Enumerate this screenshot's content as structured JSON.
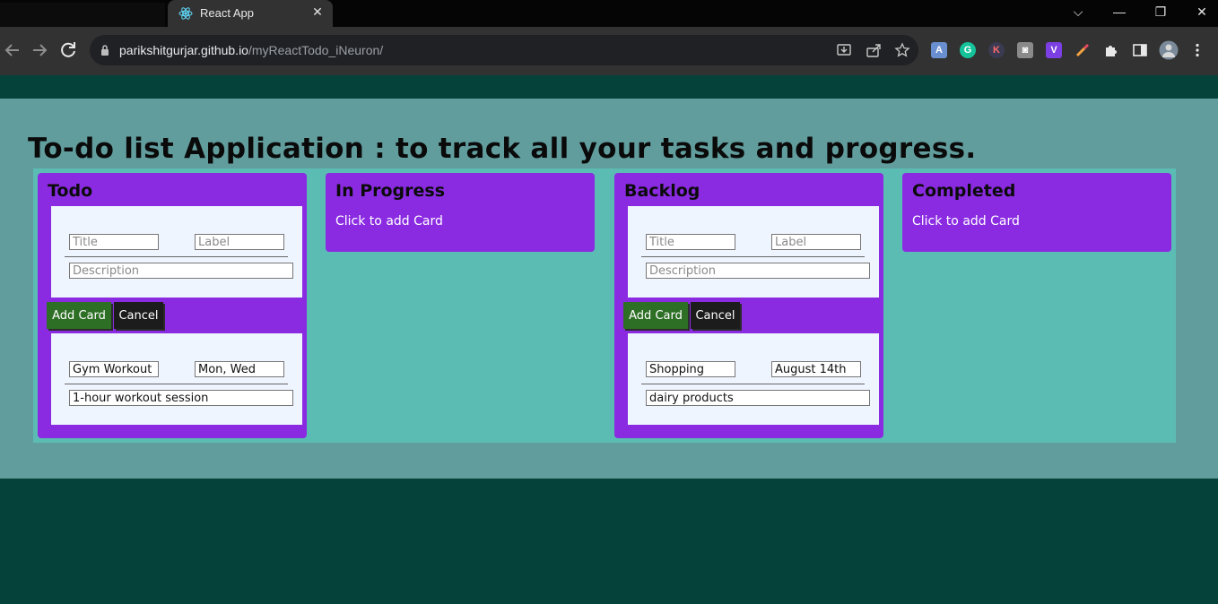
{
  "browser": {
    "tab_title": "React App",
    "url_host": "parikshitgurjar.github.io",
    "url_path": "/myReactTodo_iNeuron/",
    "tab_close": "✕",
    "controls": {
      "tab_search": "⌵",
      "minimize": "—",
      "restore": "❐",
      "close": "✕"
    },
    "extensions": [
      "A",
      "G",
      "K",
      "◙",
      "V"
    ]
  },
  "page": {
    "heading": "To-do list Application : to track all your tasks and progress."
  },
  "columns": [
    {
      "title": "Todo",
      "form": {
        "title_placeholder": "Title",
        "label_placeholder": "Label",
        "description_placeholder": "Description",
        "add_button": "Add Card",
        "cancel_button": "Cancel"
      },
      "card": {
        "title": "Gym Workout",
        "label": "Mon, Wed",
        "description": "1-hour workout session"
      }
    },
    {
      "title": "In Progress",
      "add_card_text": "Click to add Card"
    },
    {
      "title": "Backlog",
      "form": {
        "title_placeholder": "Title",
        "label_placeholder": "Label",
        "description_placeholder": "Description",
        "add_button": "Add Card",
        "cancel_button": "Cancel"
      },
      "card": {
        "title": "Shopping",
        "label": "August 14th",
        "description": "dairy products"
      }
    },
    {
      "title": "Completed",
      "add_card_text": "Click to add Card"
    }
  ],
  "colors": {
    "column_bg": "#8a2be2",
    "board_bg": "#5bbcb3",
    "page_bg": "#629d9d",
    "footer_bg": "#05433a",
    "add_button": "#2e6f26",
    "cancel_button": "#1c1c1c"
  }
}
